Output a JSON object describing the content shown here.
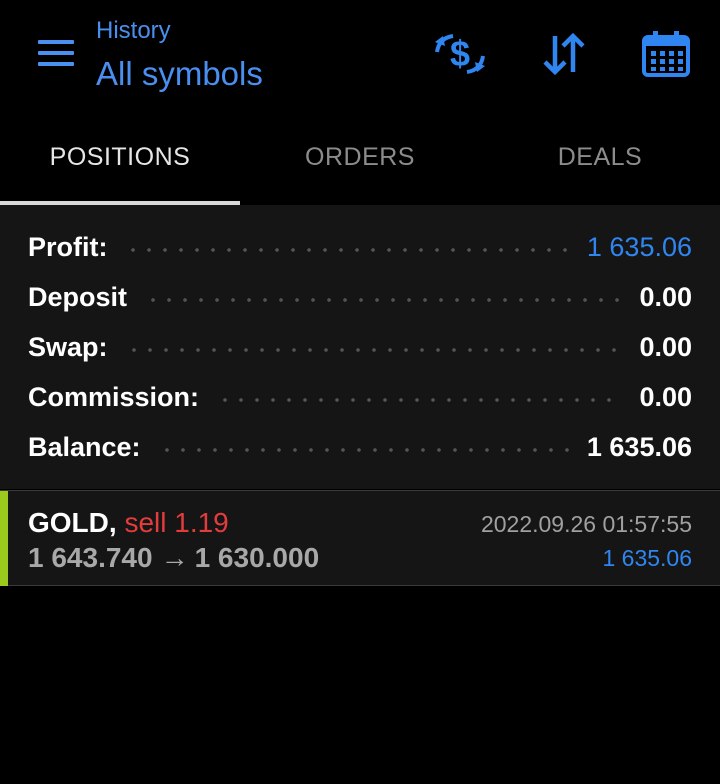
{
  "header": {
    "subtitle": "History",
    "title": "All symbols"
  },
  "colors": {
    "accent": "#4a8ff0",
    "profit_blue": "#2f86f0",
    "sell_red": "#e23c3c",
    "indicator_green": "#9acb1c"
  },
  "icons": {
    "menu": "hamburger-menu-icon",
    "symbol": "dollar-refresh-icon",
    "sort": "sort-arrows-icon",
    "period": "calendar-icon"
  },
  "tabs": [
    {
      "label": "POSITIONS",
      "active": true
    },
    {
      "label": "ORDERS",
      "active": false
    },
    {
      "label": "DEALS",
      "active": false
    }
  ],
  "summary": {
    "profit": {
      "label": "Profit:",
      "value": "1 635.06"
    },
    "deposit": {
      "label": "Deposit",
      "value": "0.00"
    },
    "swap": {
      "label": "Swap:",
      "value": "0.00"
    },
    "commission": {
      "label": "Commission:",
      "value": "0.00"
    },
    "balance": {
      "label": "Balance:",
      "value": "1 635.06"
    }
  },
  "positions": [
    {
      "symbol": "GOLD,",
      "type": "sell 1.19",
      "open_price": "1 643.740",
      "arrow": "→",
      "close_price": "1 630.000",
      "time": "2022.09.26 01:57:55",
      "profit": "1 635.06"
    }
  ]
}
